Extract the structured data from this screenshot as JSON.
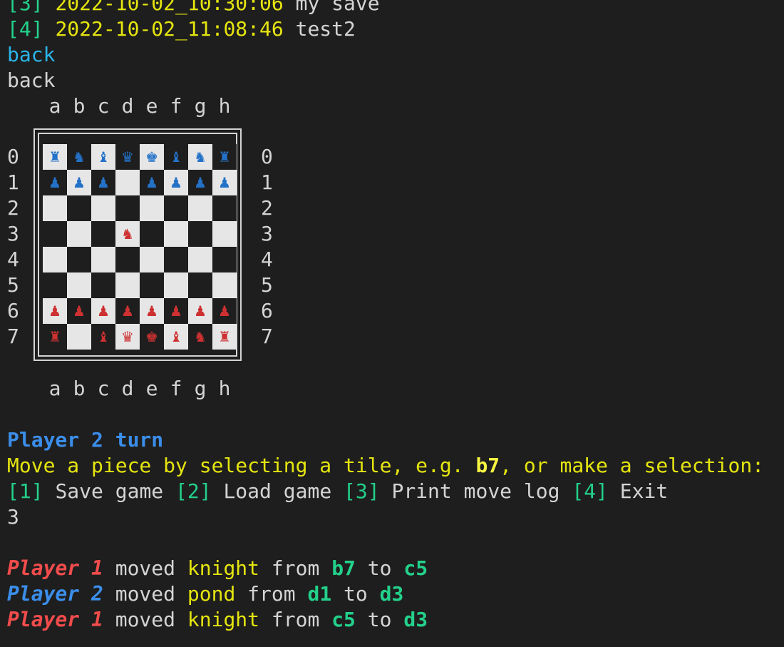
{
  "saves": [
    {
      "index": "[3]",
      "name_date": "2022-10-02_10:30:06",
      "label": "my save"
    },
    {
      "index": "[4]",
      "name_date": "2022-10-02_11:08:46",
      "label": "test2"
    }
  ],
  "back_option": "back",
  "back_echo": "back",
  "board": {
    "files": [
      "a",
      "b",
      "c",
      "d",
      "e",
      "f",
      "g",
      "h"
    ],
    "ranks": [
      "0",
      "1",
      "2",
      "3",
      "4",
      "5",
      "6",
      "7"
    ],
    "rows": [
      [
        "p2:♜",
        "p2:♞",
        "p2:♝",
        "p2:♛",
        "p2:♚",
        "p2:♝",
        "p2:♞",
        "p2:♜"
      ],
      [
        "p2:♟",
        "p2:♟",
        "p2:♟",
        "",
        "p2:♟",
        "p2:♟",
        "p2:♟",
        "p2:♟"
      ],
      [
        "",
        "",
        "",
        "",
        "",
        "",
        "",
        ""
      ],
      [
        "",
        "",
        "",
        "p1:♞",
        "",
        "",
        "",
        ""
      ],
      [
        "",
        "",
        "",
        "",
        "",
        "",
        "",
        ""
      ],
      [
        "",
        "",
        "",
        "",
        "",
        "",
        "",
        ""
      ],
      [
        "p1:♟",
        "p1:♟",
        "p1:♟",
        "p1:♟",
        "p1:♟",
        "p1:♟",
        "p1:♟",
        "p1:♟"
      ],
      [
        "p1:♜",
        "",
        "p1:♝",
        "p1:♛",
        "p1:♚",
        "p1:♝",
        "p1:♞",
        "p1:♜"
      ]
    ]
  },
  "turn": "Player 2 turn",
  "prompt": {
    "before": "Move a piece by selecting a tile, e.g. ",
    "example": "b7",
    "after": ", or make a selection:"
  },
  "menu": [
    {
      "index": "[1]",
      "label": "Save game"
    },
    {
      "index": "[2]",
      "label": "Load game"
    },
    {
      "index": "[3]",
      "label": "Print move log"
    },
    {
      "index": "[4]",
      "label": "Exit"
    }
  ],
  "user_input": "3",
  "move_log": [
    {
      "player": "Player 1",
      "verb": "moved",
      "piece": "knight",
      "from_word": "from",
      "from": "b7",
      "to_word": "to",
      "to": "c5",
      "color": "red"
    },
    {
      "player": "Player 2",
      "verb": "moved",
      "piece": "pond",
      "from_word": "from",
      "from": "d1",
      "to_word": "to",
      "to": "d3",
      "color": "blue"
    },
    {
      "player": "Player 1",
      "verb": "moved",
      "piece": "knight",
      "from_word": "from",
      "from": "c5",
      "to_word": "to",
      "to": "d3",
      "color": "red"
    }
  ],
  "colors": {
    "background": "#1e1e1e",
    "foreground": "#d4d4d4",
    "green": "#23d18b",
    "yellow": "#e5e510",
    "player1": "#f14c4c",
    "player2": "#3b8eea",
    "light_square": "#e6e6e6"
  }
}
